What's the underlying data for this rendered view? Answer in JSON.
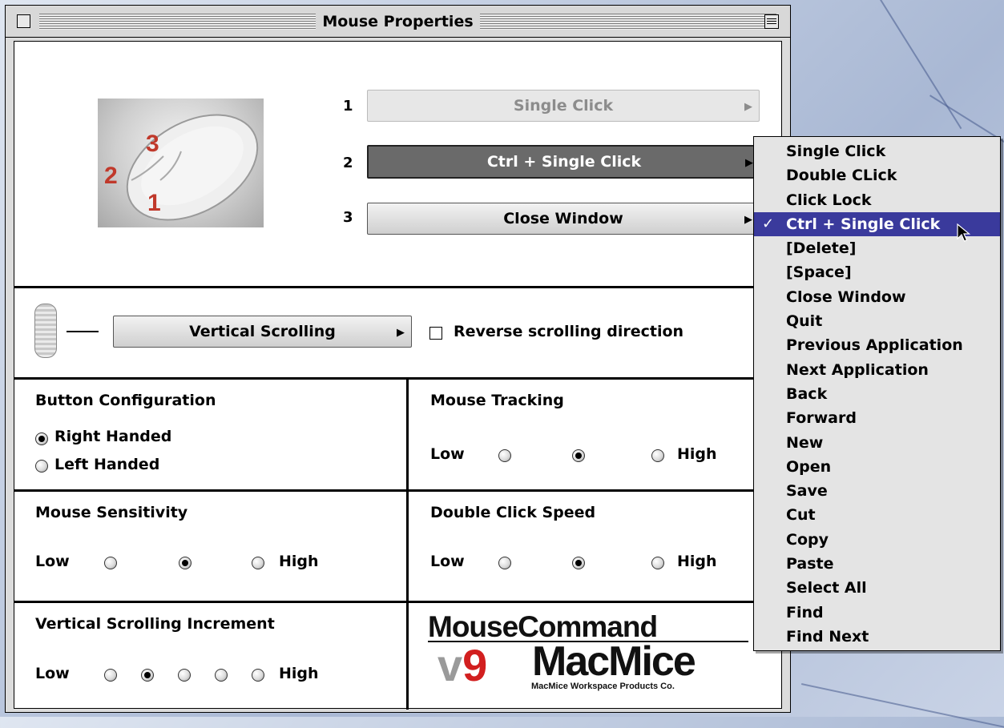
{
  "window": {
    "title": "Mouse Properties"
  },
  "buttons": {
    "rows": [
      {
        "number": "1",
        "value": "Single Click"
      },
      {
        "number": "2",
        "value": "Ctrl + Single Click"
      },
      {
        "number": "3",
        "value": "Close Window"
      }
    ]
  },
  "scrolling": {
    "mode_label": "Vertical Scrolling",
    "reverse_label": "Reverse scrolling direction",
    "reverse_checked": false
  },
  "button_configuration": {
    "title": "Button Configuration",
    "options": [
      "Right Handed",
      "Left Handed"
    ],
    "selected": "Right Handed"
  },
  "mouse_tracking": {
    "title": "Mouse Tracking",
    "low": "Low",
    "high": "High",
    "steps": 3,
    "selected_index": 1
  },
  "mouse_sensitivity": {
    "title": "Mouse Sensitivity",
    "low": "Low",
    "high": "High",
    "steps": 3,
    "selected_index": 1
  },
  "double_click_speed": {
    "title": "Double Click Speed",
    "low": "Low",
    "high": "High",
    "steps": 3,
    "selected_index": 1
  },
  "vertical_scrolling_increment": {
    "title": "Vertical Scrolling Increment",
    "low": "Low",
    "high": "High",
    "steps": 5,
    "selected_index": 1
  },
  "mouse_image": {
    "labels": [
      "1",
      "2",
      "3"
    ]
  },
  "logo": {
    "line1": "MouseCommand",
    "version_v": "v",
    "version_num": "9",
    "brand": "MacMice",
    "company": "MacMice Workspace Products Co."
  },
  "menu": {
    "selected": "Ctrl + Single Click",
    "check": "✓",
    "items": [
      "Single Click",
      "Double CLick",
      "Click Lock",
      "Ctrl + Single Click",
      "[Delete]",
      "[Space]",
      "Close Window",
      "Quit",
      "Previous Application",
      "Next Application",
      "Back",
      "Forward",
      "New",
      "Open",
      "Save",
      "Cut",
      "Copy",
      "Paste",
      "Select All",
      "Find",
      "Find Next"
    ]
  },
  "icons": {
    "close_box": "close-box-icon",
    "collapse_box": "collapse-box-icon",
    "popup_arrow": "triangle-right-icon",
    "scroll_wheel": "scroll-wheel-icon",
    "cursor": "arrow-cursor-icon"
  },
  "colors": {
    "menu_highlight": "#3a3a9c",
    "logo_red": "#d21f1f"
  }
}
